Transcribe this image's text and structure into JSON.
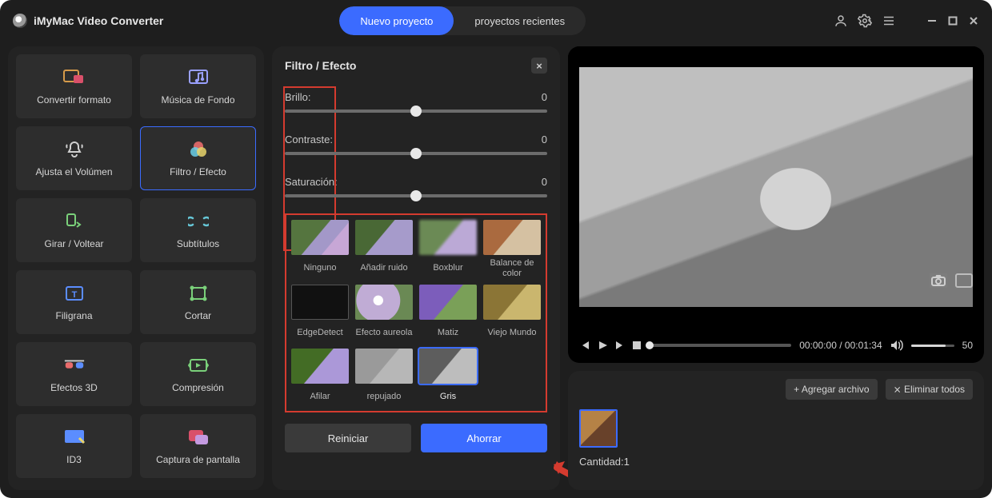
{
  "app": {
    "title": "iMyMac Video Converter"
  },
  "tabs": {
    "new_project": "Nuevo proyecto",
    "recent_projects": "proyectos recientes"
  },
  "sidebar": {
    "items": [
      {
        "label": "Convertir formato"
      },
      {
        "label": "Música de Fondo"
      },
      {
        "label": "Ajusta el Volúmen"
      },
      {
        "label": "Filtro / Efecto"
      },
      {
        "label": "Girar / Voltear"
      },
      {
        "label": "Subtítulos"
      },
      {
        "label": "Filigrana"
      },
      {
        "label": "Cortar"
      },
      {
        "label": "Efectos 3D"
      },
      {
        "label": "Compresión"
      },
      {
        "label": "ID3"
      },
      {
        "label": "Captura de pantalla"
      }
    ]
  },
  "editor": {
    "title": "Filtro / Efecto",
    "sliders": {
      "brightness_label": "Brillo:",
      "brightness_value": "0",
      "contrast_label": "Contraste:",
      "contrast_value": "0",
      "saturation_label": "Saturación:",
      "saturation_value": "0"
    },
    "filters": [
      {
        "name": "Ninguno"
      },
      {
        "name": "Añadir ruido"
      },
      {
        "name": "Boxblur"
      },
      {
        "name": "Balance de color"
      },
      {
        "name": "EdgeDetect"
      },
      {
        "name": "Efecto aureola"
      },
      {
        "name": "Matiz"
      },
      {
        "name": "Viejo Mundo"
      },
      {
        "name": "Afilar"
      },
      {
        "name": "repujado"
      },
      {
        "name": "Gris"
      }
    ],
    "buttons": {
      "reset": "Reiniciar",
      "save": "Ahorrar"
    }
  },
  "preview": {
    "time_current": "00:00:00",
    "time_total": "00:01:34",
    "volume": "50"
  },
  "clips": {
    "add_file": "+ Agregar archivo",
    "remove_all_prefix": "⨯",
    "remove_all": "Eliminar todos",
    "qty_label": "Cantidad:",
    "qty_value": "1"
  }
}
